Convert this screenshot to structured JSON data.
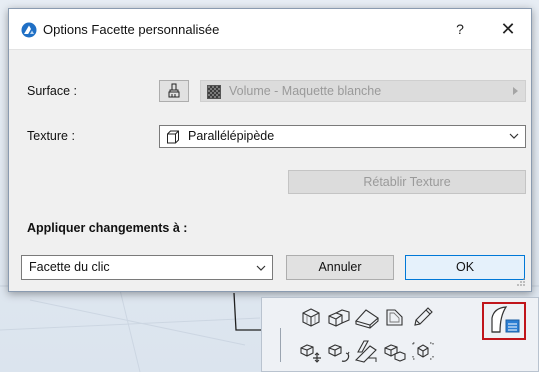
{
  "dialog": {
    "title": "Options Facette personnalisée",
    "help_label": "?",
    "close_label": "✕"
  },
  "surface": {
    "label": "Surface :",
    "value": "Volume - Maquette blanche"
  },
  "texture": {
    "label": "Texture :",
    "value": "Parallélépipède",
    "reset_label": "Rétablir Texture"
  },
  "apply": {
    "heading": "Appliquer changements à :",
    "value": "Facette du clic",
    "cancel_label": "Annuler",
    "ok_label": "OK"
  },
  "colors": {
    "accent": "#0078d7",
    "highlight": "#c0151b",
    "disabled_text": "#9a9a9a"
  },
  "toolbar": {
    "icons": [
      "box-view-icon",
      "multi-box-icon",
      "slab-shape-icon",
      "face-shape-icon",
      "pencil-icon",
      "custom-facet-icon",
      "move-facet-icon",
      "rotate-facet-icon",
      "skew-facet-icon",
      "scale-facet-icon",
      "explode-box-icon"
    ]
  }
}
